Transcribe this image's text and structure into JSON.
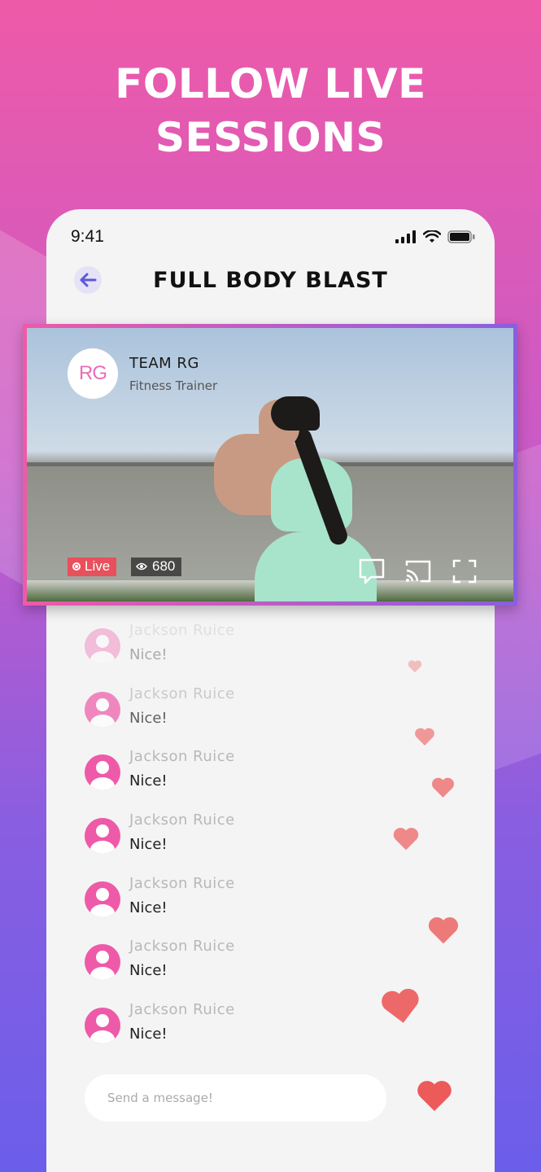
{
  "headline": "FOLLOW LIVE\nSESSIONS",
  "status_bar": {
    "time": "9:41"
  },
  "nav": {
    "title": "FULL BODY BLAST"
  },
  "video": {
    "trainer_logo": "RG",
    "trainer_name": "TEAM RG",
    "trainer_role": "Fitness Trainer",
    "live_label": "Live",
    "viewer_count": "680"
  },
  "chat": [
    {
      "user": "Jackson Ruice",
      "message": "Nice!",
      "opacity": 0.35
    },
    {
      "user": "Jackson Ruice",
      "message": "Nice!",
      "opacity": 0.7
    },
    {
      "user": "Jackson Ruice",
      "message": "Nice!",
      "opacity": 1
    },
    {
      "user": "Jackson Ruice",
      "message": "Nice!",
      "opacity": 1
    },
    {
      "user": "Jackson Ruice",
      "message": "Nice!",
      "opacity": 1
    },
    {
      "user": "Jackson Ruice",
      "message": "Nice!",
      "opacity": 1
    },
    {
      "user": "Jackson Ruice",
      "message": "Nice!",
      "opacity": 1
    }
  ],
  "message_input": {
    "placeholder": "Send a message!"
  },
  "colors": {
    "accent_pink": "#ee5aa8",
    "accent_purple": "#6b5eea",
    "live_red": "#e8505b",
    "heart": "#ec5a5a"
  }
}
